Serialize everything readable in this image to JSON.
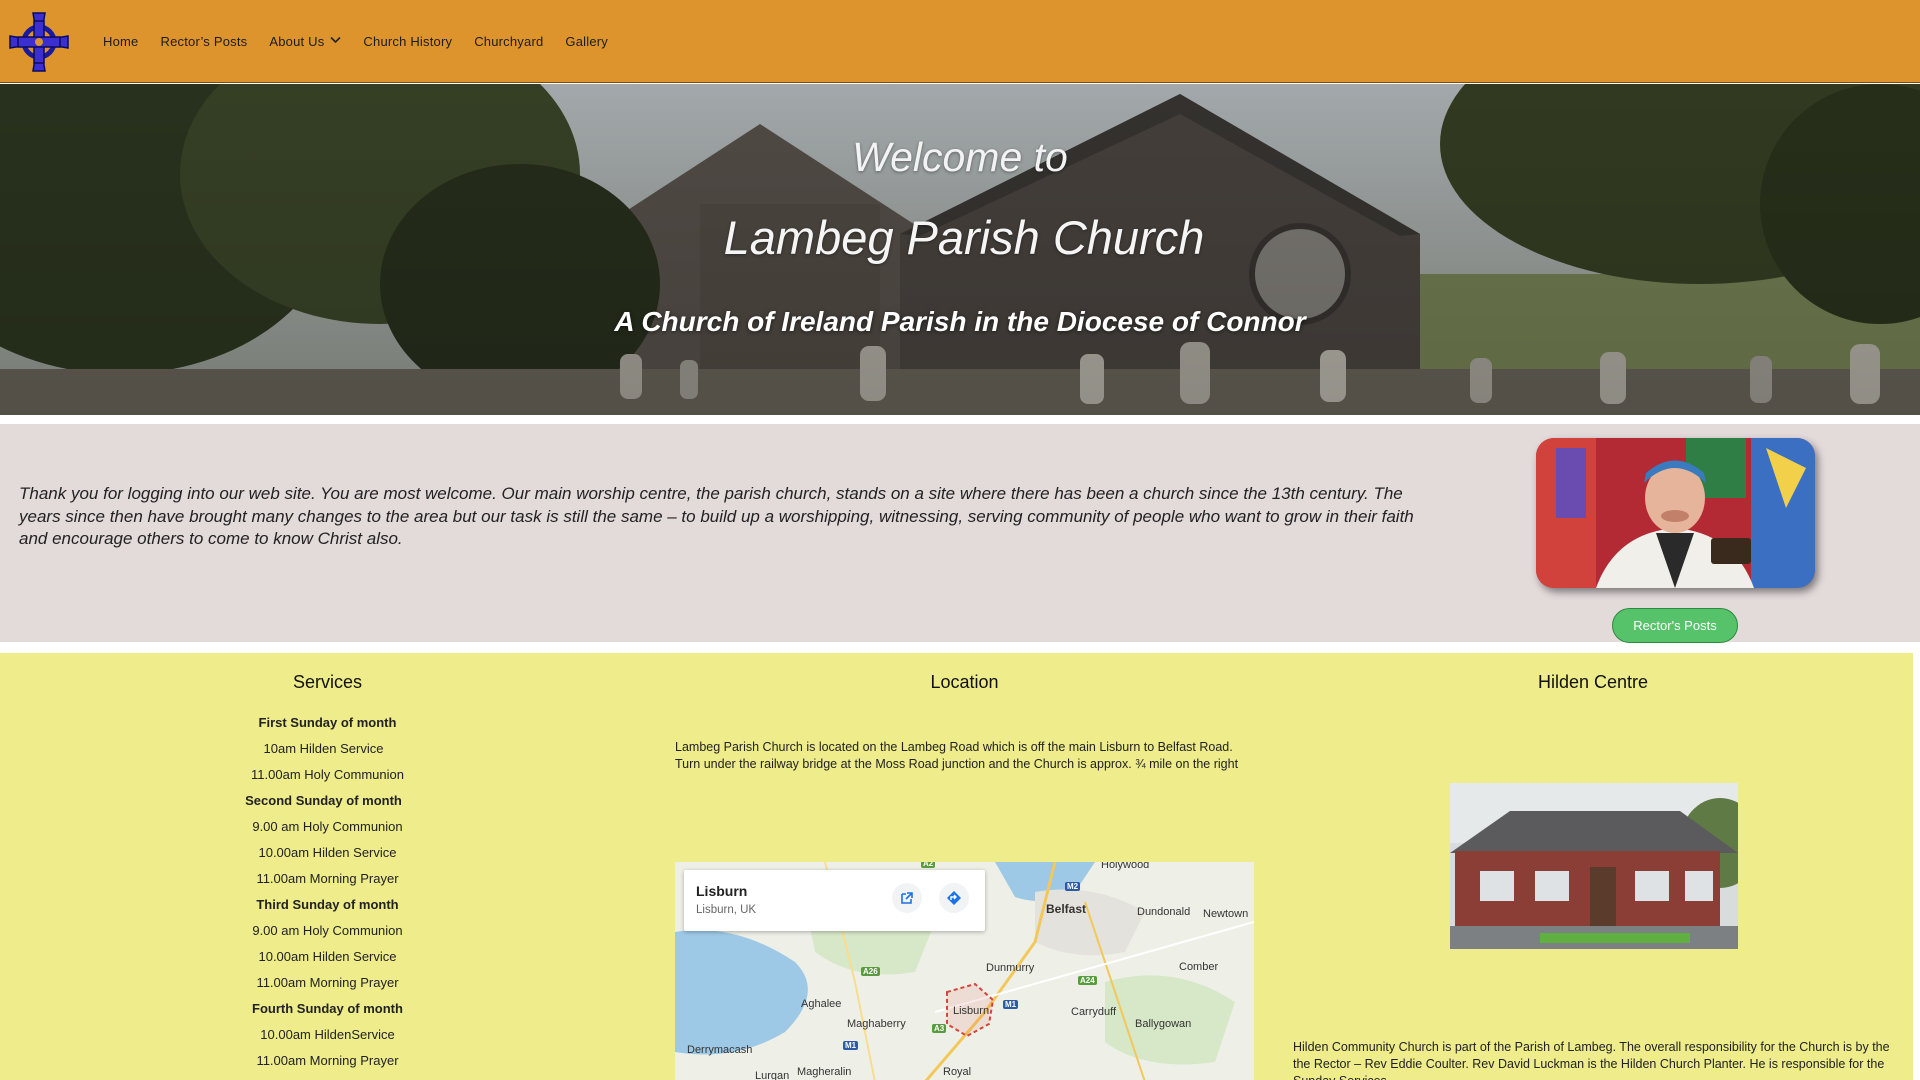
{
  "nav": {
    "items": [
      {
        "label": "Home"
      },
      {
        "label": "Rector’s Posts"
      },
      {
        "label": "About Us"
      },
      {
        "label": "Church History"
      },
      {
        "label": "Churchyard"
      },
      {
        "label": "Gallery"
      }
    ],
    "logo_icon": "celtic-cross-icon",
    "dropdown_icon": "chevron-down-icon"
  },
  "hero": {
    "line1": "Welcome to",
    "line2": "Lambeg Parish Church",
    "line3": "A Church of Ireland Parish in the Diocese of Connor"
  },
  "welcome": {
    "text": "Thank you for logging into our web site. You are most welcome. Our main worship centre, the parish church, stands on a site where there has been a church since the 13th century.  The years since then have brought many changes to the area but our task is still the same – to build up a worshipping, witnessing, serving community of people who want to grow in their faith and encourage others to come to know Christ also.",
    "button_label": "Rector's Posts"
  },
  "services": {
    "title": "Services",
    "lines": [
      {
        "text": "First Sunday of month",
        "bold": true
      },
      {
        "text": "10am Hilden Service",
        "bold": false
      },
      {
        "text": "11.00am Holy Communion",
        "bold": false
      },
      {
        "text": "Second Sunday of month",
        "bold": true
      },
      {
        "text": "9.00 am Holy Communion",
        "bold": false
      },
      {
        "text": "10.00am Hilden Service",
        "bold": false
      },
      {
        "text": "11.00am Morning Prayer",
        "bold": false
      },
      {
        "text": "Third Sunday of month",
        "bold": true
      },
      {
        "text": "9.00 am Holy Communion",
        "bold": false
      },
      {
        "text": "10.00am Hilden Service",
        "bold": false
      },
      {
        "text": "11.00am Morning Prayer",
        "bold": false
      },
      {
        "text": "Fourth Sunday of month",
        "bold": true
      },
      {
        "text": "10.00am HildenService",
        "bold": false
      },
      {
        "text": "11.00am Morning Prayer",
        "bold": false
      }
    ]
  },
  "location": {
    "title": "Location",
    "text": "Lambeg Parish Church is located on the Lambeg Road which is off the main Lisburn to Belfast Road. Turn under the railway bridge at the Moss Road junction and the Church is approx. ¾ mile  on the right",
    "map": {
      "card_title": "Lisburn",
      "card_subtitle": "Lisburn, UK",
      "labels": [
        "Holywood",
        "Belfast",
        "Dundonald",
        "Newtown",
        "Dunmurry",
        "Comber",
        "Aghalee",
        "Maghaberry",
        "Lisburn",
        "Carryduff",
        "Ballygowan",
        "Derrymacash",
        "Lurgan",
        "Magheralin",
        "Royal"
      ],
      "roads": [
        "A2",
        "M2",
        "A26",
        "A24",
        "M1",
        "A3",
        "M1"
      ]
    }
  },
  "hilden": {
    "title": "Hilden Centre",
    "text": "Hilden Community Church is part of the Parish of Lambeg. The overall responsibility for the Church is by the the Rector – Rev Eddie Coulter. Rev David Luckman is the Hilden Church Planter. He is responsible for the Sunday Services"
  }
}
